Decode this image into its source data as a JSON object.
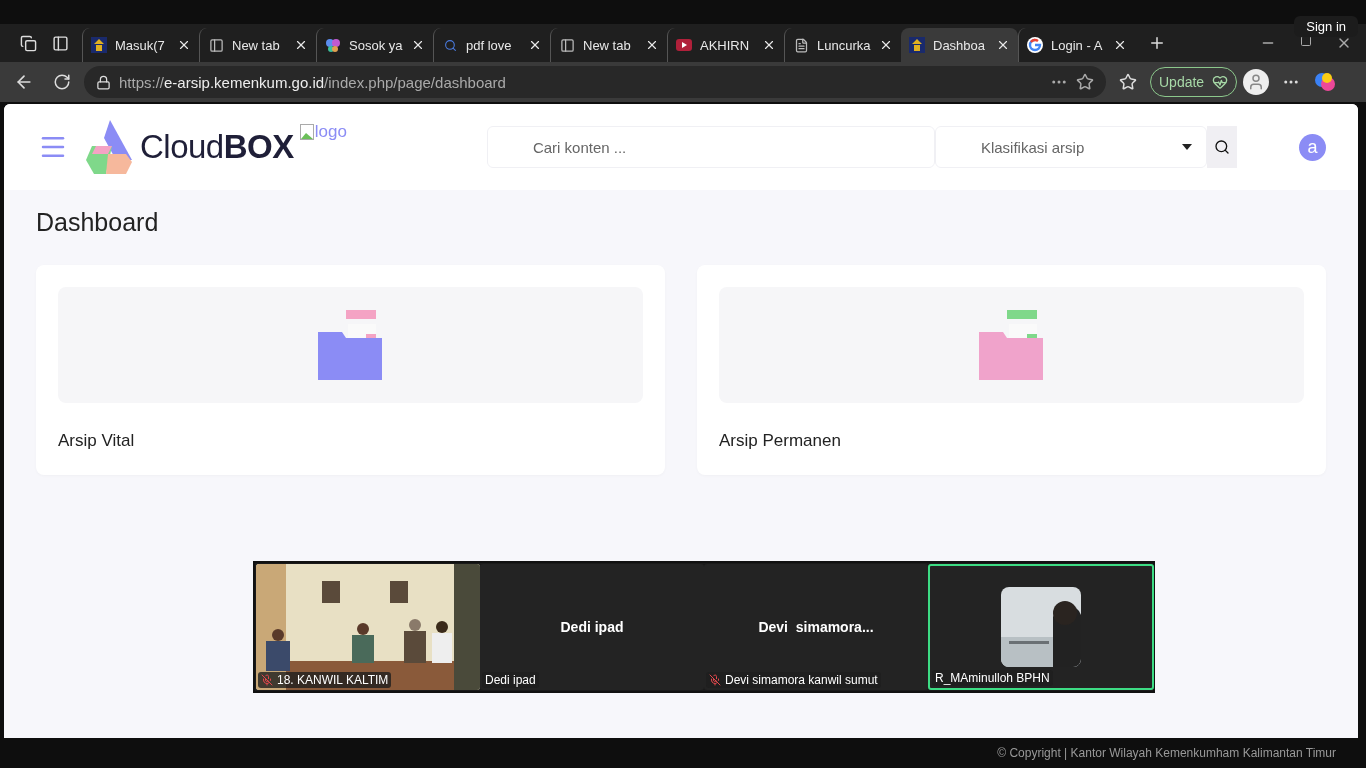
{
  "browser": {
    "tabs": [
      {
        "kind": "site",
        "label": "Masuk(7",
        "selected": false
      },
      {
        "kind": "newtab",
        "label": "New tab",
        "selected": false
      },
      {
        "kind": "butterfly",
        "label": "Sosok ya",
        "selected": false
      },
      {
        "kind": "search",
        "label": "pdf love",
        "selected": false
      },
      {
        "kind": "newtab",
        "label": "New tab",
        "selected": false
      },
      {
        "kind": "video",
        "label": "AKHIRN",
        "selected": false
      },
      {
        "kind": "page",
        "label": "Luncurka",
        "selected": false
      },
      {
        "kind": "site",
        "label": "Dashboa",
        "selected": true
      },
      {
        "kind": "google",
        "label": "Login - A",
        "selected": false
      }
    ],
    "sign_in": "Sign in",
    "url": {
      "scheme": "https://",
      "host": "e-arsip.kemenkum.go.id",
      "path": "/index.php/page/dashboard"
    },
    "update_button": "Update"
  },
  "header": {
    "brand": {
      "light": "Cloud",
      "bold": "BOX"
    },
    "logo_alt": "logo",
    "search_placeholder": "Cari konten ...",
    "classification_placeholder": "Klasifikasi arsip",
    "avatar": "a"
  },
  "page_title": "Dashboard",
  "cards": [
    {
      "label": "Arsip Vital",
      "color": "#8b8cf5",
      "tab": {
        "color": "#f4a3c4"
      }
    },
    {
      "label": "Arsip Permanen",
      "color": "#f0a3cb",
      "tab": {
        "color": "#7fd88a"
      }
    }
  ],
  "meeting": {
    "tiles": [
      {
        "kind": "video",
        "label": "18. KANWIL KALTIM",
        "muted": true,
        "active": false
      },
      {
        "kind": "name",
        "title": "Dedi ipad",
        "label": "Dedi ipad",
        "muted": false,
        "active": false
      },
      {
        "kind": "name",
        "title": "Devi  simamora...",
        "label": "Devi simamora kanwil sumut",
        "muted": true,
        "active": false
      },
      {
        "kind": "camera",
        "label": "R_MAminulloh BPHN",
        "muted": false,
        "active": true
      }
    ]
  },
  "footer": "© Copyright | Kantor Wilayah Kemenkumham Kalimantan Timur"
}
